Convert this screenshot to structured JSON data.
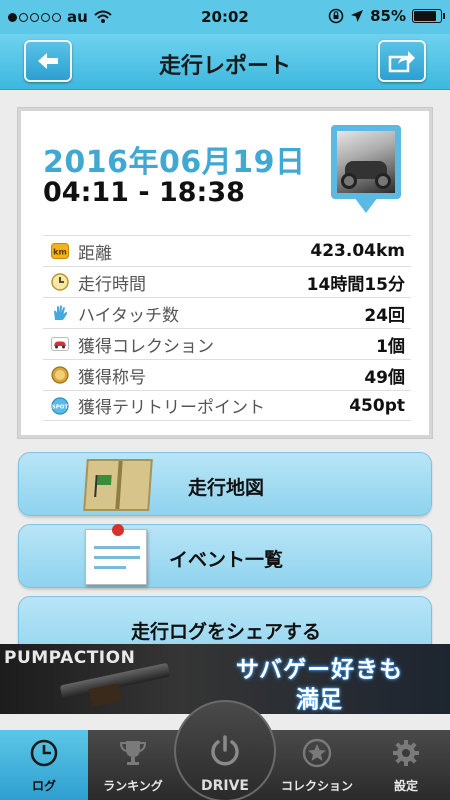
{
  "status_bar": {
    "carrier": "au",
    "time": "20:02",
    "battery": "85%",
    "battery_level": 0.85
  },
  "header": {
    "title": "走行レポート",
    "back_icon": "back-arrow-icon",
    "share_icon": "share-icon"
  },
  "report": {
    "date": "2016年06月19日",
    "time_range": "04:11 - 18:38",
    "stats": [
      {
        "label": "距離",
        "value": "423.04km",
        "icon": "distance-km-icon"
      },
      {
        "label": "走行時間",
        "value": "14時間15分",
        "icon": "clock-icon"
      },
      {
        "label": "ハイタッチ数",
        "value": "24回",
        "icon": "hand-icon"
      },
      {
        "label": "獲得コレクション",
        "value": "1個",
        "icon": "car-icon"
      },
      {
        "label": "獲得称号",
        "value": "49個",
        "icon": "medal-icon"
      },
      {
        "label": "獲得テリトリーポイント",
        "value": "450pt",
        "icon": "spot-icon"
      }
    ]
  },
  "actions": {
    "map_label": "走行地図",
    "events_label": "イベント一覧",
    "share_label": "走行ログをシェアする"
  },
  "ad": {
    "brand": "PUMPACTION",
    "copy_line1": "サバゲー好きも",
    "copy_line2": "満足"
  },
  "tabs": {
    "log": "ログ",
    "ranking": "ランキング",
    "drive": "DRIVE",
    "collection": "コレクション",
    "settings": "設定"
  },
  "colors": {
    "accent": "#5cc7e6",
    "date_blue": "#41a8d2",
    "button_blue": "#a7ddf2"
  }
}
